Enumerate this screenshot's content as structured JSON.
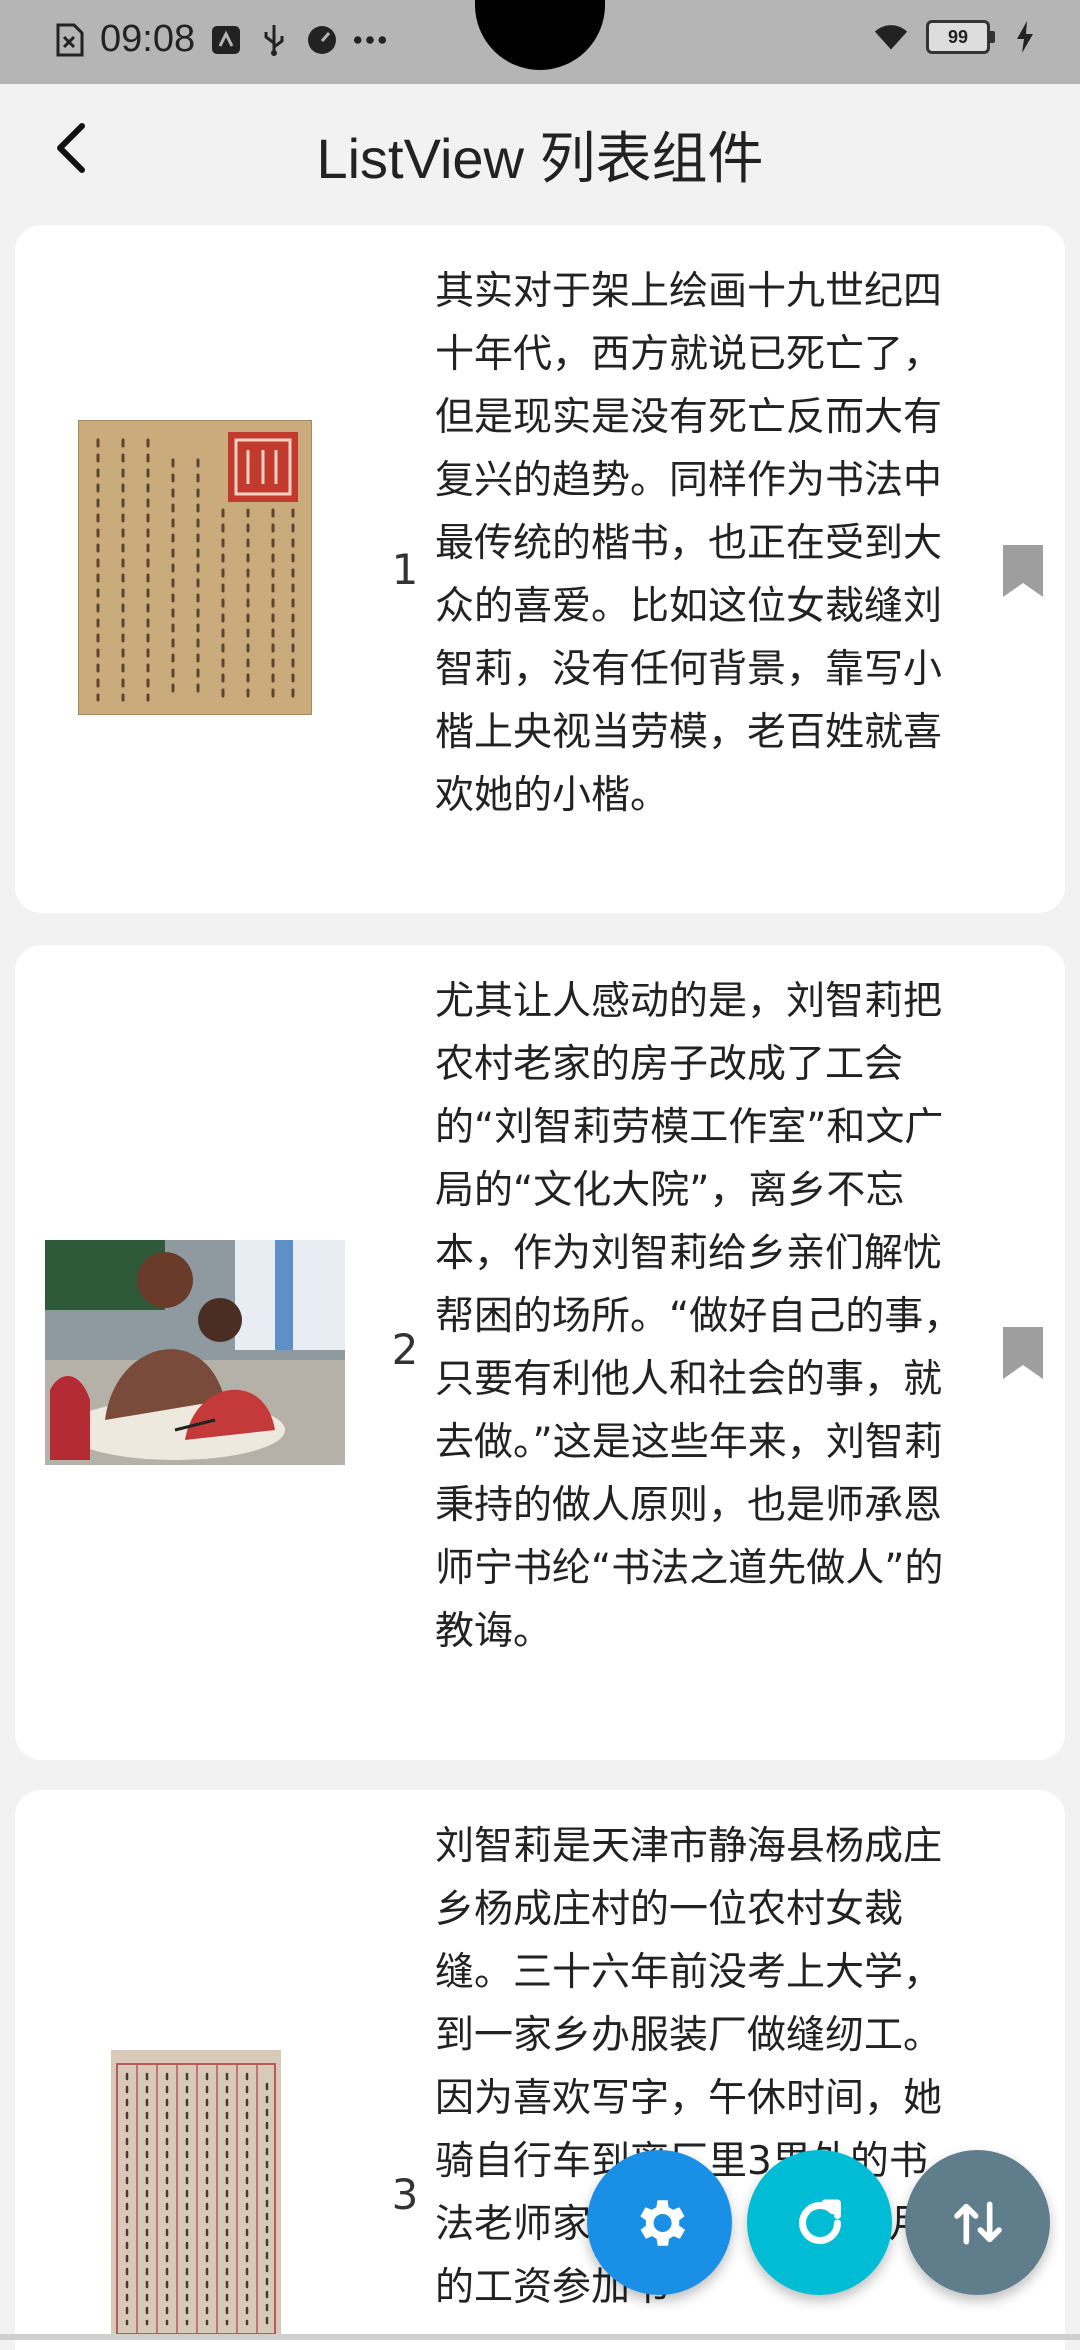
{
  "status_bar": {
    "time": "09:08",
    "icons_left": [
      "sim-off-icon",
      "usb-debug-icon",
      "usb-icon",
      "speedometer-icon",
      "more-icon"
    ],
    "battery_level": "99",
    "icons_right": [
      "wifi-icon",
      "battery-icon",
      "charging-icon"
    ]
  },
  "app_bar": {
    "title": "ListView 列表组件",
    "back_icon": "chevron-left-icon"
  },
  "items": [
    {
      "index": "1",
      "text": "其实对于架上绘画十九世纪四十年代，西方就说已死亡了，但是现实是没有死亡反而大有复兴的趋势。同样作为书法中最传统的楷书，也正在受到大众的喜爱。比如这位女裁缝刘智莉，没有任何背景，靠写小楷上央视当劳模，老百姓就喜欢她的小楷。",
      "image": "calligraphy-scroll-with-red-seal"
    },
    {
      "index": "2",
      "text": "尤其让人感动的是，刘智莉把农村老家的房子改成了工会的“刘智莉劳模工作室”和文广局的“文化大院”，离乡不忘本，作为刘智莉给乡亲们解忧帮困的场所。“做好自己的事，只要有利他人和社会的事，就去做。”这是这些年来，刘智莉秉持的做人原则，也是师承恩师宁书纶“书法之道先做人”的教诲。",
      "image": "teacher-guiding-child-calligraphy"
    },
    {
      "index": "3",
      "text": "刘智莉是天津市静海县杨成庄乡杨成庄村的一位农村女裁缝。三十六年前没考上大学，到一家乡办服装厂做缝纫工。因为喜欢写字，午休时间，她骑自行车到离厂里3里外的书法老师家中请教。花了7个月的工资参加书",
      "image": "thousand-character-classic-manuscript"
    }
  ],
  "fabs": [
    {
      "icon": "gear-icon",
      "color": "#1a8fe6"
    },
    {
      "icon": "refresh-icon",
      "color": "#00bcd4"
    },
    {
      "icon": "swap-vertical-icon",
      "color": "#607d8b"
    }
  ],
  "colors": {
    "status_bar_bg": "#b5b5b5",
    "page_bg": "#f2f2f2",
    "card_bg": "#ffffff",
    "bookmark": "#9e9e9e"
  }
}
